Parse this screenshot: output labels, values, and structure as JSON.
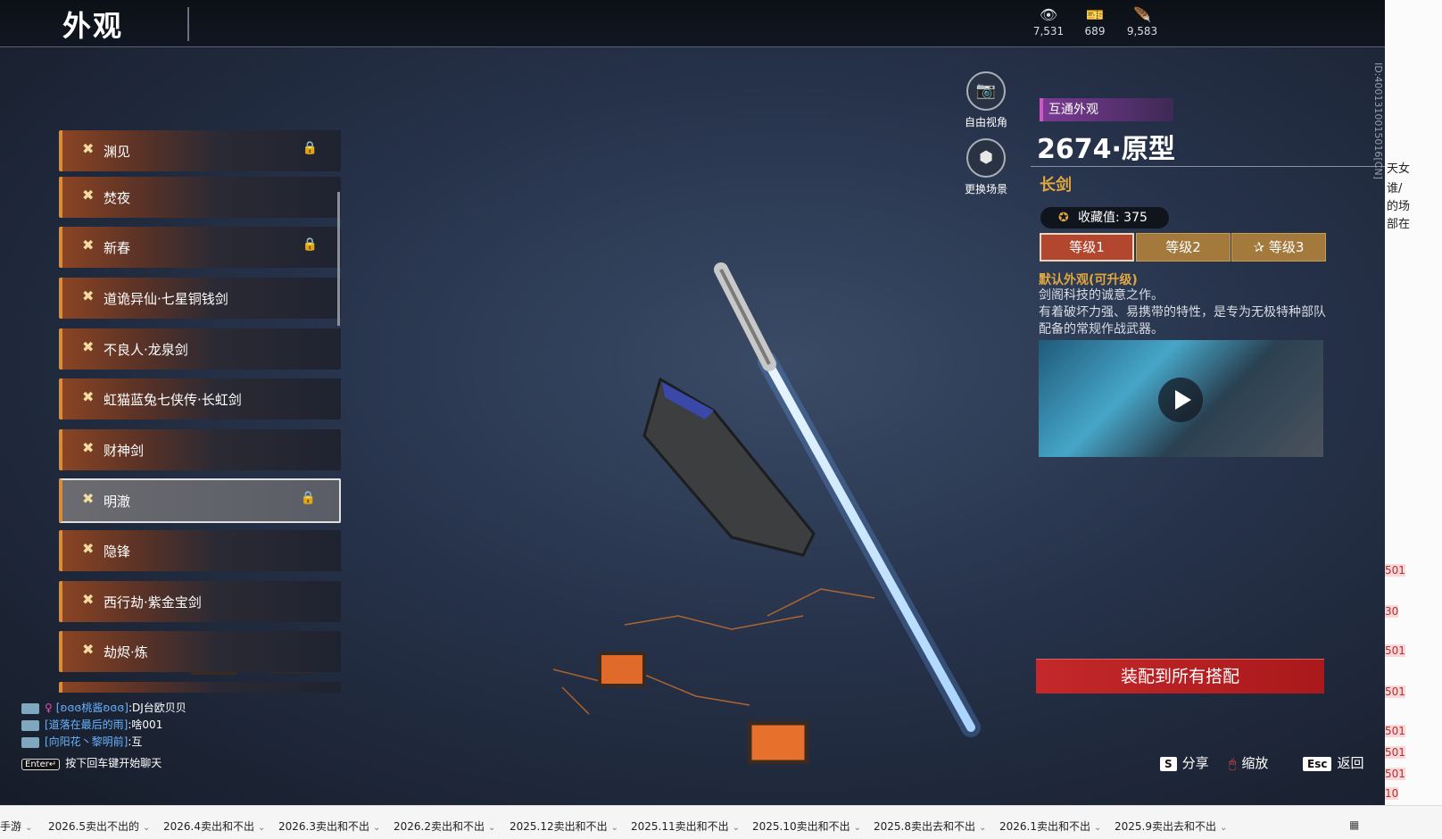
{
  "header": {
    "title": "外观"
  },
  "currencies": [
    {
      "icon": "eye-coin-icon",
      "glyph": "👁",
      "value": "7,531"
    },
    {
      "icon": "gold-ticket-icon",
      "glyph": "🎫",
      "value": "689"
    },
    {
      "icon": "feather-icon",
      "glyph": "🪶",
      "value": "9,583"
    }
  ],
  "list": {
    "items": [
      {
        "label": "渊见",
        "locked": true,
        "lock": "🔒"
      },
      {
        "label": "焚夜",
        "locked": false,
        "lock": ""
      },
      {
        "label": "新春",
        "locked": true,
        "lock": "🔒"
      },
      {
        "label": "道诡异仙·七星铜钱剑",
        "locked": false,
        "lock": ""
      },
      {
        "label": "不良人·龙泉剑",
        "locked": false,
        "lock": ""
      },
      {
        "label": "虹猫蓝兔七侠传·长虹剑",
        "locked": false,
        "lock": ""
      },
      {
        "label": "财神剑",
        "locked": false,
        "lock": ""
      },
      {
        "label": "明澈",
        "locked": true,
        "lock": "🔒",
        "selected": true
      },
      {
        "label": "隐锋",
        "locked": false,
        "lock": ""
      },
      {
        "label": "西行劫·紫金宝剑",
        "locked": false,
        "lock": ""
      },
      {
        "label": "劫烬·炼",
        "locked": false,
        "lock": ""
      }
    ],
    "mark_glyph": "✖"
  },
  "view_buttons": {
    "free_view": {
      "label": "自由视角",
      "glyph": "📷"
    },
    "change_scene": {
      "label": "更换场景",
      "glyph": "⬢"
    }
  },
  "detail": {
    "tag": "互通外观",
    "name": "2674·原型",
    "type": "长剑",
    "collect_icon": "✪",
    "collect_label": "收藏值: 375",
    "tiers": [
      {
        "label": "等级1",
        "active": true
      },
      {
        "label": "等级2",
        "active": false
      },
      {
        "label": "✰ 等级3",
        "active": false
      }
    ],
    "desc_title": "默认外观(可升级)",
    "desc_lines": [
      "剑阁科技的诚意之作。",
      "有着破坏力强、易携带的特性，是专为无极特种部队配备的常规作战武器。"
    ],
    "id_text": "ID:4001310015016[CN]",
    "equip_label": "装配到所有搭配"
  },
  "chat": {
    "lines": [
      {
        "sym": "♀",
        "name": "[ʚɞɞ桃酱ʚɞɞ]",
        "msg": ":DJ台欧贝贝"
      },
      {
        "sym": "",
        "name": "[道落在最后的雨]",
        "msg": ":啥001"
      },
      {
        "sym": "",
        "name": "[向阳花丶黎明前]",
        "msg": ":互"
      }
    ],
    "hint_key": "Enter↵",
    "hint": "按下回车键开始聊天"
  },
  "actions": {
    "share_key": "S",
    "share": "分享",
    "zoom_key": "🖱",
    "zoom": "缩放",
    "back_key": "Esc",
    "back": "返回"
  },
  "sliver": {
    "texts": [
      "天女",
      "谁/",
      "的场",
      "部在"
    ],
    "reds": [
      "501",
      "30",
      "501",
      "501",
      "501",
      "501",
      "501",
      "10"
    ]
  },
  "taskbar": {
    "tabs": [
      "手游",
      "2026.5卖出不出的",
      "2026.4卖出和不出",
      "2026.3卖出和不出",
      "2026.2卖出和不出",
      "2025.12卖出和不出",
      "2025.11卖出和不出",
      "2025.10卖出和不出",
      "2025.8卖出去和不出",
      "2026.1卖出和不出",
      "2025.9卖出去和不出"
    ],
    "menu_glyph": "▦"
  }
}
